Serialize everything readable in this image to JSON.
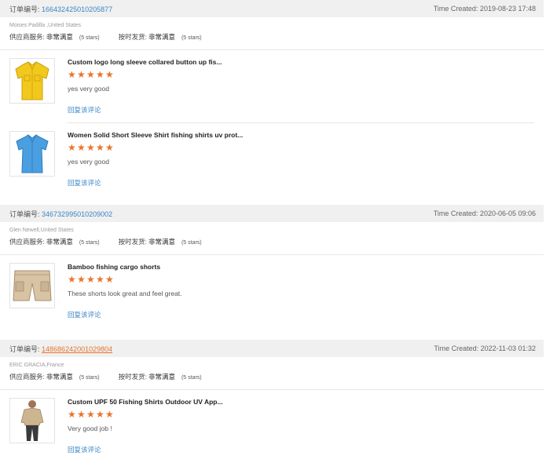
{
  "orders": [
    {
      "order_label": "订单编号:",
      "order_number": "166432425010205877",
      "time_created": "Time Created: 2019-08-23 17:48",
      "buyer": "Moises Padilla ,United States",
      "supplier_service_label": "供应商服务:",
      "supplier_service_value": "非常满意",
      "supplier_service_stars": "(5 stars)",
      "shipping_label": "按时发货:",
      "shipping_value": "非常满意",
      "shipping_stars": "(5 stars)",
      "items": [
        {
          "title": "Custom logo long sleeve collared button up fis...",
          "feedback": "yes very good",
          "reply": "回复该评论",
          "thumb": "yellow-shirt-icon"
        },
        {
          "title": "Women Solid Short Sleeve Shirt fishing shirts uv prot...",
          "feedback": "yes very good",
          "reply": "回复该评论",
          "thumb": "blue-shirt-icon"
        }
      ]
    },
    {
      "order_label": "订单编号:",
      "order_number": "346732995010209002",
      "time_created": "Time Created: 2020-06-05 09:06",
      "buyer": "Glen Newell,United States",
      "supplier_service_label": "供应商服务:",
      "supplier_service_value": "非常满意",
      "supplier_service_stars": "(5 stars)",
      "shipping_label": "按时发货:",
      "shipping_value": "非常满意",
      "shipping_stars": "(5 stars)",
      "items": [
        {
          "title": "Bamboo fishing cargo shorts",
          "feedback": "These shorts look great and feel great.",
          "reply": "回复该评论",
          "thumb": "cargo-shorts-icon"
        }
      ]
    },
    {
      "order_label": "订单编号:",
      "order_number": "148686242001029804",
      "time_created": "Time Created: 2022-11-03 01:32",
      "buyer": "ERIC GRACIA,France",
      "supplier_service_label": "供应商服务:",
      "supplier_service_value": "非常满意",
      "supplier_service_stars": "(5 stars)",
      "shipping_label": "按时发货:",
      "shipping_value": "非常满意",
      "shipping_stars": "(5 stars)",
      "items": [
        {
          "title": "Custom UPF 50 Fishing Shirts Outdoor UV App...",
          "feedback": "Very good job !",
          "reply": "回复该评论",
          "thumb": "man-shirt-icon"
        }
      ]
    }
  ],
  "colors": {
    "link": "#3b86c4",
    "star": "#e8742b",
    "header_bg": "#f0f0f0",
    "order_number_highlight": "#e8742b"
  }
}
